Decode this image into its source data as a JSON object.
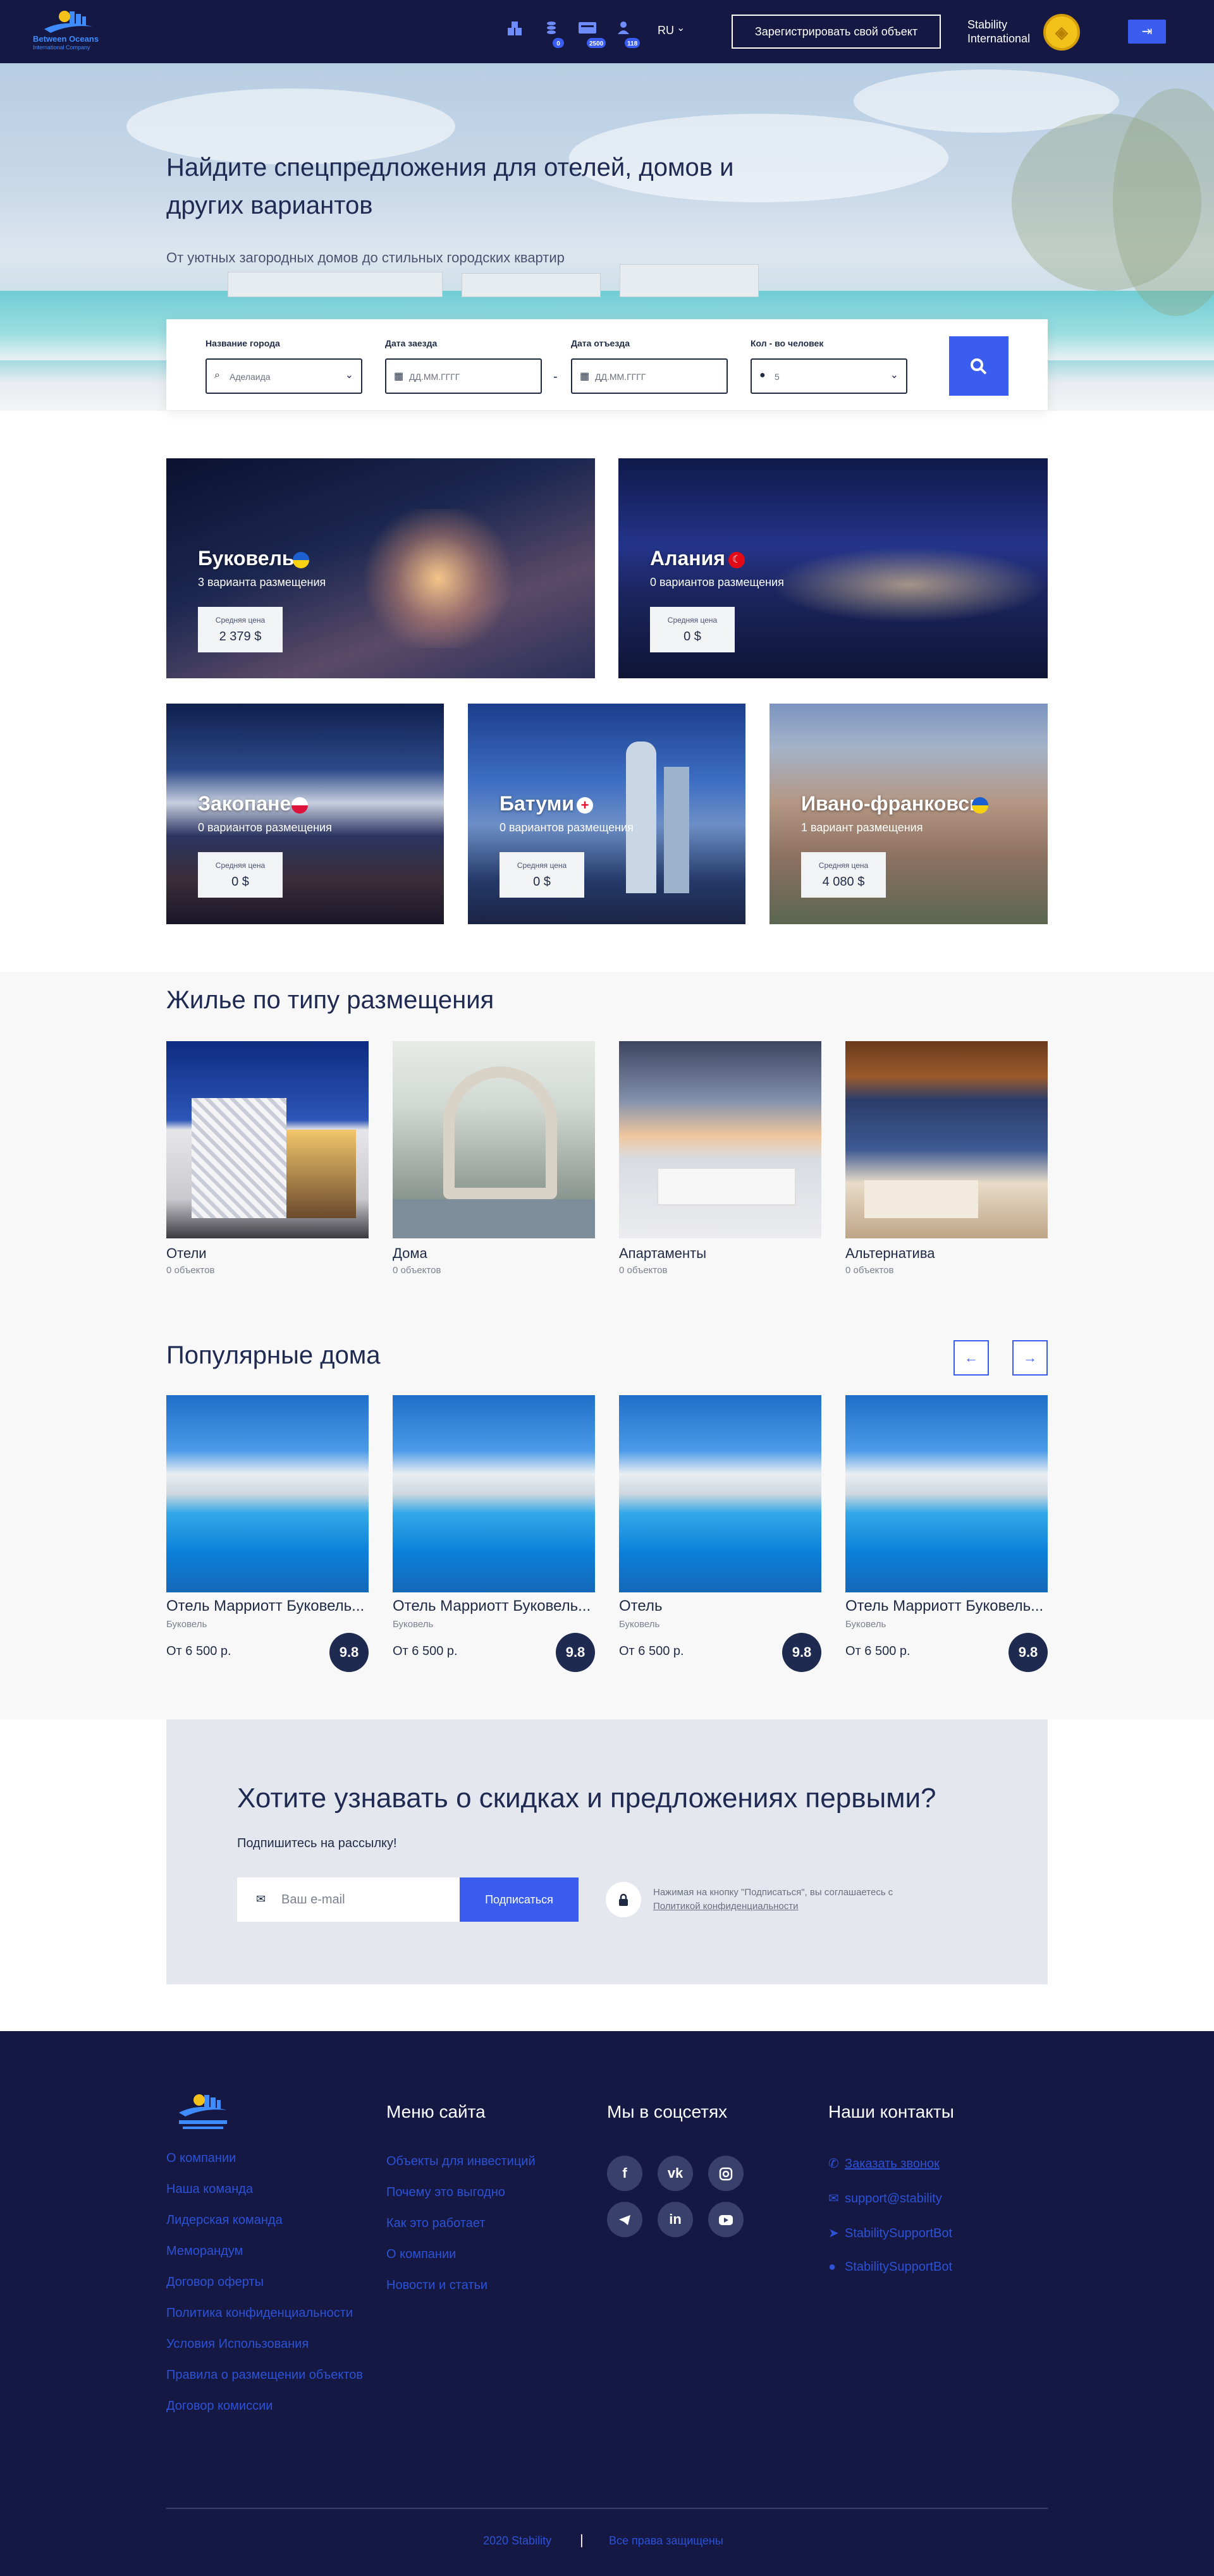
{
  "header": {
    "logo_text": "Between Oceans",
    "logo_subtext": "International Company",
    "badges": [
      "0",
      "2500",
      "118"
    ],
    "language": "RU",
    "register_label": "Зарегистрировать свой объект",
    "stability_line1": "Stability",
    "stability_line2": "International"
  },
  "hero": {
    "title": "Найдите спецпредложения для отелей, домов и других вариантов",
    "subtitle": "От уютных загородных домов до стильных городских квартир"
  },
  "search": {
    "city_label": "Название города",
    "city_value": "Аделаида",
    "checkin_label": "Дата заезда",
    "checkin_placeholder": "ДД.ММ.ГГГГ",
    "checkout_label": "Дата отъезда",
    "checkout_placeholder": "ДД.ММ.ГГГГ",
    "guests_label": "Кол - во человек",
    "guests_value": "5"
  },
  "destinations": [
    {
      "name": "Буковель",
      "count": "3 варианта размещения",
      "price_label": "Средняя цена",
      "price": "2 379 $"
    },
    {
      "name": "Алания",
      "count": "0 вариантов размещения",
      "price_label": "Средняя цена",
      "price": "0 $"
    },
    {
      "name": "Закопане",
      "count": "0 вариантов размещения",
      "price_label": "Средняя цена",
      "price": "0 $"
    },
    {
      "name": "Батуми",
      "count": "0 вариантов размещения",
      "price_label": "Средняя цена",
      "price": "0 $"
    },
    {
      "name": "Ивано-франковск",
      "count": "1 вариант размещения",
      "price_label": "Средняя цена",
      "price": "4 080 $"
    }
  ],
  "types": {
    "title": "Жилье по типу размещения",
    "items": [
      {
        "name": "Отели",
        "count": "0 объектов"
      },
      {
        "name": "Дома",
        "count": "0 объектов"
      },
      {
        "name": "Апартаменты",
        "count": "0 объектов"
      },
      {
        "name": "Альтернатива",
        "count": "0 объектов"
      }
    ]
  },
  "popular": {
    "title": "Популярные дома",
    "prev": "←",
    "next": "→",
    "items": [
      {
        "name": "Отель Марриотт Буковель...",
        "city": "Буковель",
        "price": "От 6 500 р.",
        "rating": "9.8"
      },
      {
        "name": "Отель Марриотт Буковель...",
        "city": "Буковель",
        "price": "От 6 500 р.",
        "rating": "9.8"
      },
      {
        "name": "Отель",
        "city": "Буковель",
        "price": "От 6 500 р.",
        "rating": "9.8"
      },
      {
        "name": "Отель Марриотт Буковель...",
        "city": "Буковель",
        "price": "От 6 500 р.",
        "rating": "9.8"
      }
    ]
  },
  "newsletter": {
    "title": "Хотите узнавать о скидках и предложениях первыми?",
    "subtitle": "Подпишитесь на рассылку!",
    "email_placeholder": "Ваш e-mail",
    "button": "Подписаться",
    "note": "Нажимая на кнопку \"Подписаться\", вы соглашаетесь с",
    "policy_link": "Политикой конфиденциальности"
  },
  "footer": {
    "links": [
      "О компании",
      "Наша команда",
      "Лидерская команда",
      "Меморандум",
      "Договор оферты",
      "Политика конфиденциальности",
      "Условия Использования",
      "Правила о размещении объектов",
      "Договор комиссии"
    ],
    "menu_title": "Меню сайта",
    "menu": [
      "Объекты для инвестиций",
      "Почему это выгодно",
      "Как это работает",
      "О компании",
      "Новости и статьи"
    ],
    "social_title": "Мы в соцсетях",
    "contacts_title": "Наши контакты",
    "contacts": [
      "Заказать звонок",
      "support@stability",
      "StabilitySupportBot",
      "StabilitySupportBot"
    ],
    "copyright": "2020 Stability",
    "rights": "Все права защищены"
  }
}
